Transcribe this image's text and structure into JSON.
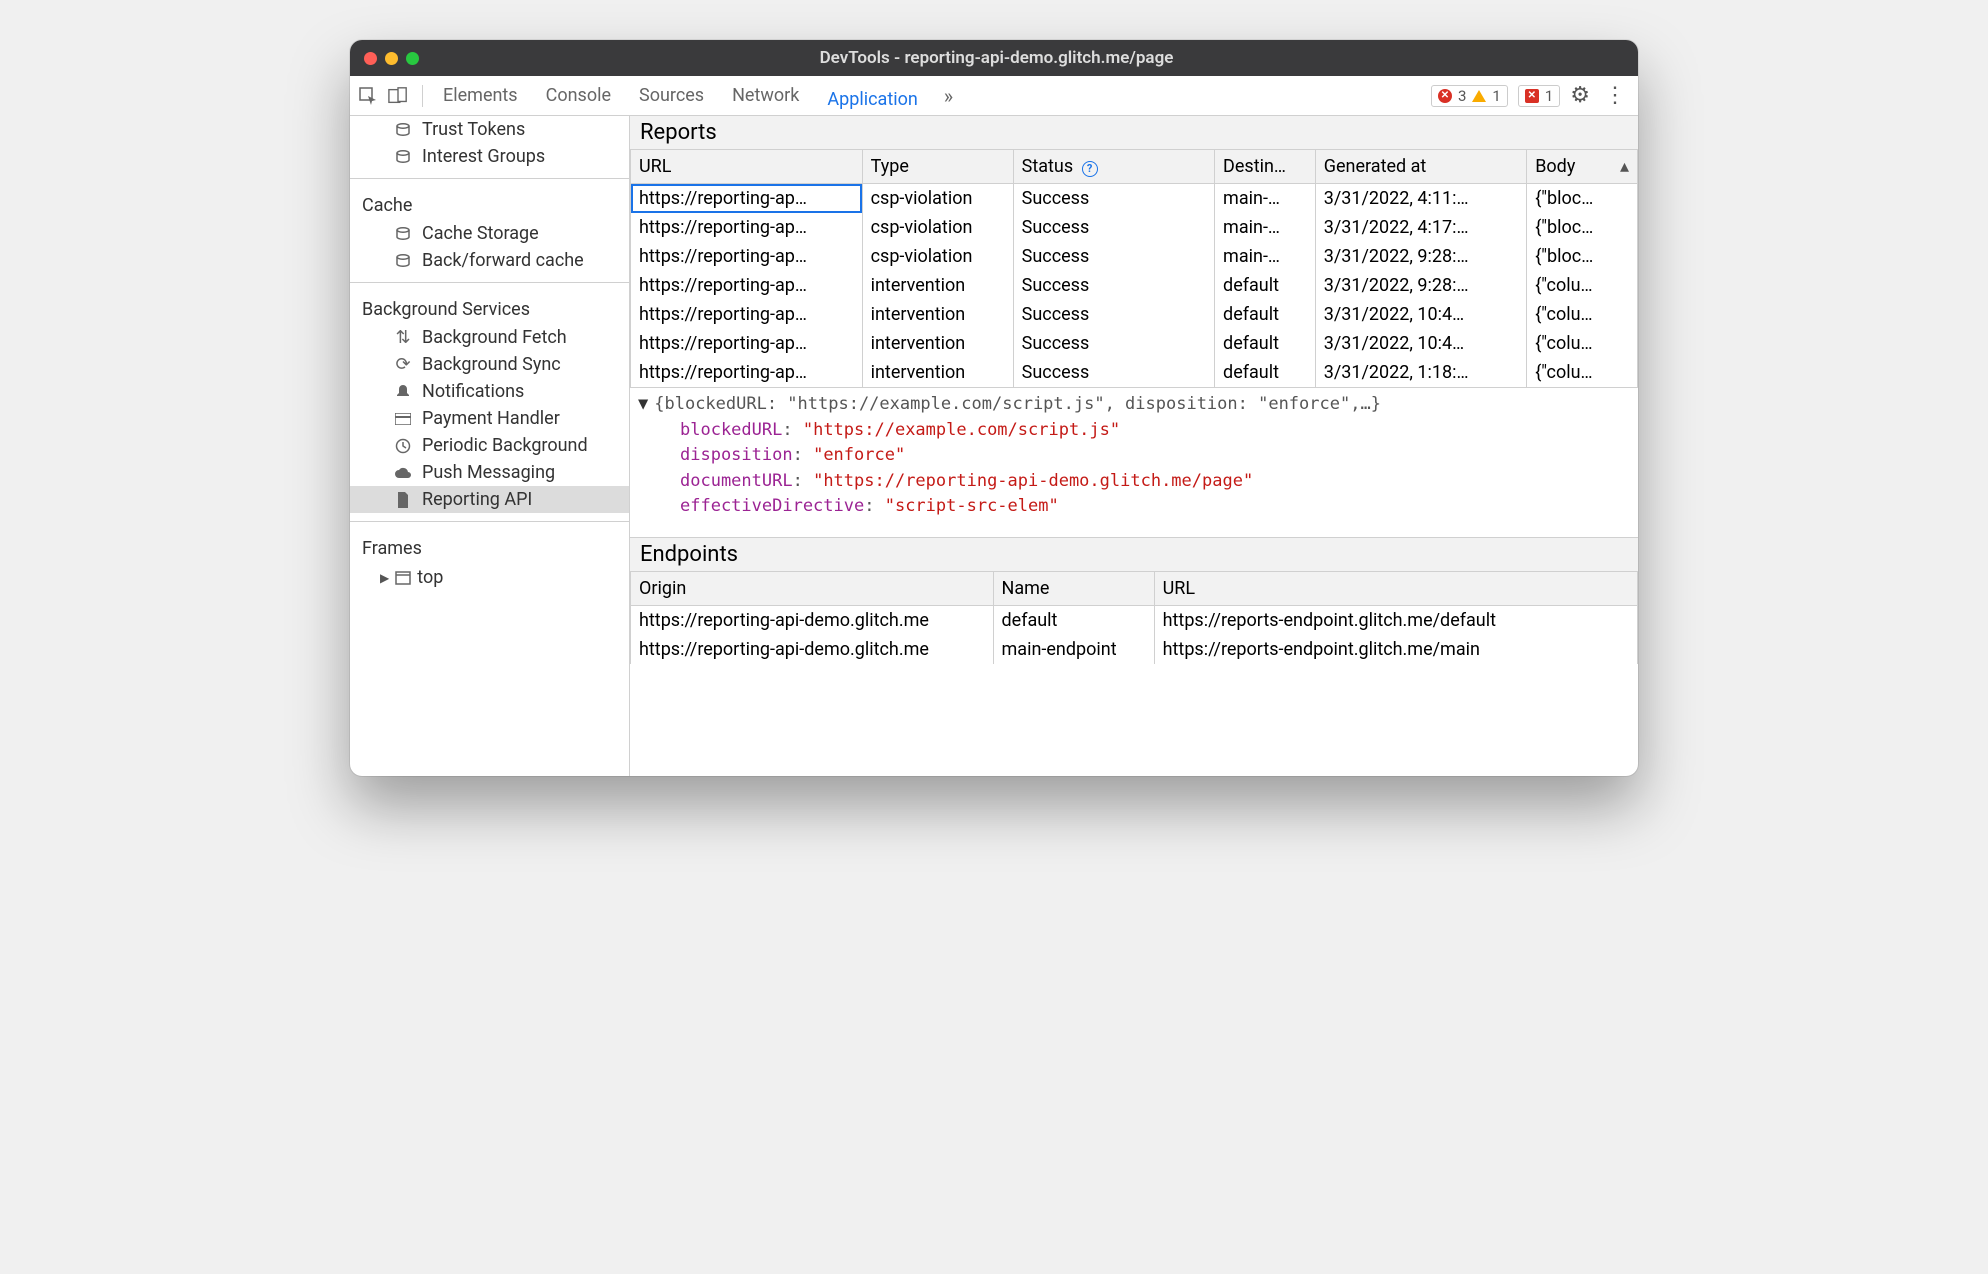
{
  "window": {
    "title": "DevTools - reporting-api-demo.glitch.me/page"
  },
  "toolbar": {
    "tabs": [
      "Elements",
      "Console",
      "Sources",
      "Network",
      "Application"
    ],
    "active": "Application",
    "errors": "3",
    "warnings": "1",
    "issues": "1"
  },
  "sidebar": {
    "top_items": [
      {
        "icon": "db",
        "label": "Trust Tokens"
      },
      {
        "icon": "db",
        "label": "Interest Groups"
      }
    ],
    "cache": {
      "title": "Cache",
      "items": [
        {
          "icon": "db",
          "label": "Cache Storage"
        },
        {
          "icon": "db",
          "label": "Back/forward cache"
        }
      ]
    },
    "bg": {
      "title": "Background Services",
      "items": [
        {
          "icon": "fetch",
          "label": "Background Fetch"
        },
        {
          "icon": "sync",
          "label": "Background Sync"
        },
        {
          "icon": "bell",
          "label": "Notifications"
        },
        {
          "icon": "card",
          "label": "Payment Handler"
        },
        {
          "icon": "clock",
          "label": "Periodic Background"
        },
        {
          "icon": "cloud",
          "label": "Push Messaging"
        },
        {
          "icon": "doc",
          "label": "Reporting API",
          "selected": true
        }
      ]
    },
    "frames": {
      "title": "Frames",
      "top": "top"
    }
  },
  "reports": {
    "title": "Reports",
    "columns": [
      "URL",
      "Type",
      "Status",
      "Destin…",
      "Generated at",
      "Body"
    ],
    "rows": [
      {
        "url": "https://reporting-ap…",
        "type": "csp-violation",
        "status": "Success",
        "dest": "main-…",
        "gen": "3/31/2022, 4:11:…",
        "body": "{\"bloc…",
        "selected": true
      },
      {
        "url": "https://reporting-ap…",
        "type": "csp-violation",
        "status": "Success",
        "dest": "main-…",
        "gen": "3/31/2022, 4:17:…",
        "body": "{\"bloc…"
      },
      {
        "url": "https://reporting-ap…",
        "type": "csp-violation",
        "status": "Success",
        "dest": "main-…",
        "gen": "3/31/2022, 9:28:…",
        "body": "{\"bloc…"
      },
      {
        "url": "https://reporting-ap…",
        "type": "intervention",
        "status": "Success",
        "dest": "default",
        "gen": "3/31/2022, 9:28:…",
        "body": "{\"colu…"
      },
      {
        "url": "https://reporting-ap…",
        "type": "intervention",
        "status": "Success",
        "dest": "default",
        "gen": "3/31/2022, 10:4…",
        "body": "{\"colu…"
      },
      {
        "url": "https://reporting-ap…",
        "type": "intervention",
        "status": "Success",
        "dest": "default",
        "gen": "3/31/2022, 10:4…",
        "body": "{\"colu…"
      },
      {
        "url": "https://reporting-ap…",
        "type": "intervention",
        "status": "Success",
        "dest": "default",
        "gen": "3/31/2022, 1:18:…",
        "body": "{\"colu…"
      }
    ]
  },
  "detail": {
    "summary": "{blockedURL: \"https://example.com/script.js\", disposition: \"enforce\",…}",
    "props": [
      {
        "k": "blockedURL",
        "v": "\"https://example.com/script.js\""
      },
      {
        "k": "disposition",
        "v": "\"enforce\""
      },
      {
        "k": "documentURL",
        "v": "\"https://reporting-api-demo.glitch.me/page\""
      },
      {
        "k": "effectiveDirective",
        "v": "\"script-src-elem\""
      }
    ]
  },
  "endpoints": {
    "title": "Endpoints",
    "columns": [
      "Origin",
      "Name",
      "URL"
    ],
    "rows": [
      {
        "origin": "https://reporting-api-demo.glitch.me",
        "name": "default",
        "url": "https://reports-endpoint.glitch.me/default"
      },
      {
        "origin": "https://reporting-api-demo.glitch.me",
        "name": "main-endpoint",
        "url": "https://reports-endpoint.glitch.me/main"
      }
    ]
  }
}
